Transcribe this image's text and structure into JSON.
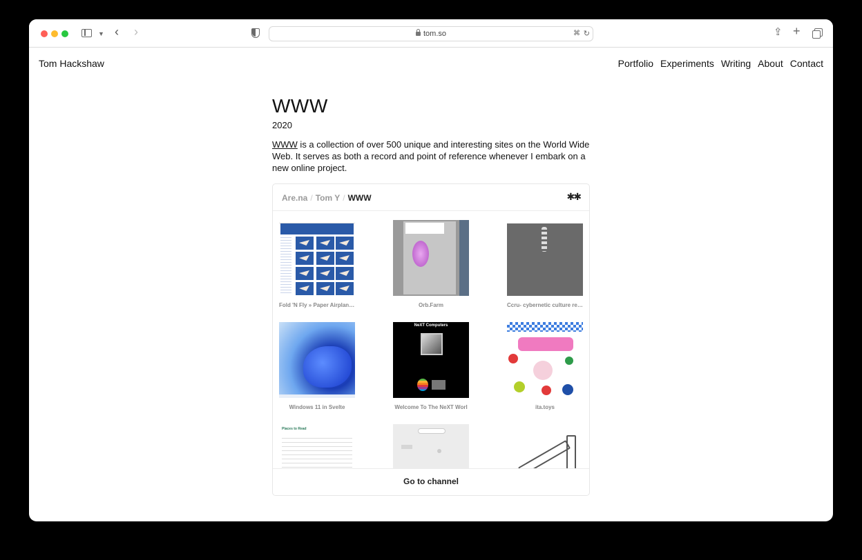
{
  "browser": {
    "url": "tom.so",
    "icons": [
      "sidebar-icon",
      "chevron-down-icon",
      "back-icon",
      "forward-icon",
      "shield-icon",
      "lock-icon",
      "translate-icon",
      "reload-icon",
      "share-icon",
      "plus-icon",
      "tabs-icon"
    ]
  },
  "site": {
    "name": "Tom Hackshaw",
    "nav": [
      "Portfolio",
      "Experiments",
      "Writing",
      "About",
      "Contact"
    ]
  },
  "page": {
    "title": "WWW",
    "year": "2020",
    "desc_link": "WWW",
    "desc_text": " is a collection of over 500 unique and interesting sites on the World Wide Web. It serves as both a record and point of reference whenever I embark on a new online project."
  },
  "embed": {
    "crumbs": [
      "Are.na",
      "Tom Y",
      "WWW"
    ],
    "logo": "✱✱",
    "items": [
      {
        "caption": "Fold 'N Fly » Paper Airplane Designs"
      },
      {
        "caption": "Orb.Farm"
      },
      {
        "caption": "Ccru- cybernetic culture research unit"
      },
      {
        "caption": "Windows 11 in Svelte"
      },
      {
        "caption": "Welcome To The NeXT Worl"
      },
      {
        "caption": "ita.toys"
      },
      {
        "caption": ""
      },
      {
        "caption": ""
      },
      {
        "caption": ""
      }
    ],
    "next_header": "NeXT Computers",
    "sheet_header": "Places to Read",
    "footer_button": "Go to channel"
  }
}
